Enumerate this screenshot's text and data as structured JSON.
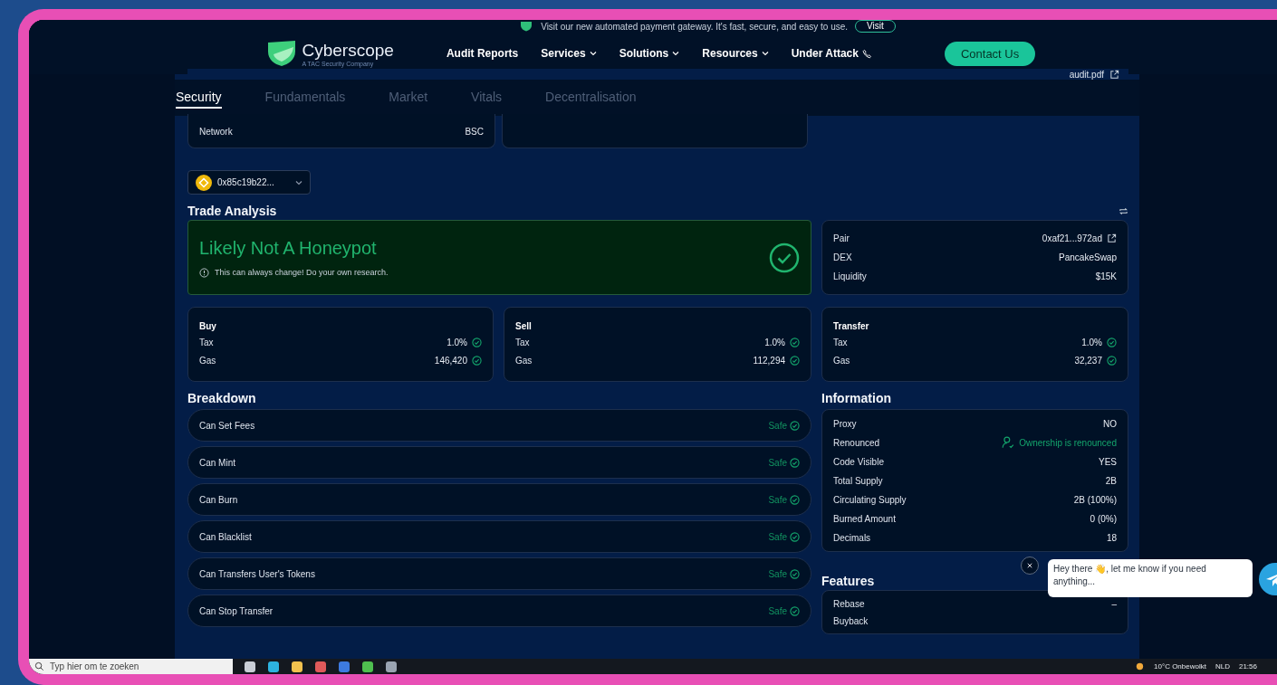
{
  "banner": {
    "text": "Visit our new automated payment gateway. It's fast, secure, and easy to use.",
    "button": "Visit"
  },
  "nav": {
    "logo": "Cyberscope",
    "tagline": "A TAC Security Company",
    "links": [
      {
        "label": "Audit Reports",
        "kind": "link"
      },
      {
        "label": "Services",
        "kind": "dropdown"
      },
      {
        "label": "Solutions",
        "kind": "dropdown"
      },
      {
        "label": "Resources",
        "kind": "dropdown"
      },
      {
        "label": "Under Attack",
        "kind": "phone"
      }
    ],
    "contact": "Contact Us"
  },
  "audit_file": "audit.pdf",
  "tabs": [
    {
      "label": "Security",
      "selected": true
    },
    {
      "label": "Fundamentals",
      "selected": false
    },
    {
      "label": "Market",
      "selected": false
    },
    {
      "label": "Vitals",
      "selected": false
    },
    {
      "label": "Decentralisation",
      "selected": false
    }
  ],
  "network": {
    "label": "Network",
    "value": "BSC"
  },
  "token_select": "0x85c19b22...",
  "trade_analysis": {
    "title": "Trade Analysis",
    "verdict": "Likely Not A Honeypot",
    "note": "This can always change! Do your own research.",
    "pair_rows": [
      {
        "label": "Pair",
        "value": "0xaf21...972ad",
        "kind": "link"
      },
      {
        "label": "DEX",
        "value": "PancakeSwap",
        "kind": "text"
      },
      {
        "label": "Liquidity",
        "value": "$15K",
        "kind": "text"
      }
    ],
    "cards": [
      {
        "title": "Buy",
        "rows": [
          {
            "label": "Tax",
            "value": "1.0%"
          },
          {
            "label": "Gas",
            "value": "146,420"
          }
        ]
      },
      {
        "title": "Sell",
        "rows": [
          {
            "label": "Tax",
            "value": "1.0%"
          },
          {
            "label": "Gas",
            "value": "112,294"
          }
        ]
      },
      {
        "title": "Transfer",
        "rows": [
          {
            "label": "Tax",
            "value": "1.0%"
          },
          {
            "label": "Gas",
            "value": "32,237"
          }
        ]
      }
    ]
  },
  "breakdown": {
    "title": "Breakdown",
    "items": [
      {
        "label": "Can Set Fees",
        "status": "Safe"
      },
      {
        "label": "Can Mint",
        "status": "Safe"
      },
      {
        "label": "Can Burn",
        "status": "Safe"
      },
      {
        "label": "Can Blacklist",
        "status": "Safe"
      },
      {
        "label": "Can Transfers User's Tokens",
        "status": "Safe"
      },
      {
        "label": "Can Stop Transfer",
        "status": "Safe"
      }
    ]
  },
  "information": {
    "title": "Information",
    "rows": [
      {
        "label": "Proxy",
        "value": "NO",
        "kind": "text"
      },
      {
        "label": "Renounced",
        "value": "Ownership is renounced",
        "kind": "renounced"
      },
      {
        "label": "Code Visible",
        "value": "YES",
        "kind": "text"
      },
      {
        "label": "Total Supply",
        "value": "2B",
        "kind": "text"
      },
      {
        "label": "Circulating Supply",
        "value": "2B (100%)",
        "kind": "text"
      },
      {
        "label": "Burned Amount",
        "value": "0 (0%)",
        "kind": "text"
      },
      {
        "label": "Decimals",
        "value": "18",
        "kind": "text"
      }
    ]
  },
  "features": {
    "title": "Features",
    "rows": [
      {
        "label": "Rebase",
        "value": "–"
      },
      {
        "label": "Buyback"
      }
    ]
  },
  "chat": {
    "message": "Hey there 👋, let me know if you need anything..."
  },
  "taskbar": {
    "search_placeholder": "Typ hier om te zoeken",
    "weather": "10°C  Onbewolkt",
    "language": "NLD",
    "time": "21:56"
  }
}
